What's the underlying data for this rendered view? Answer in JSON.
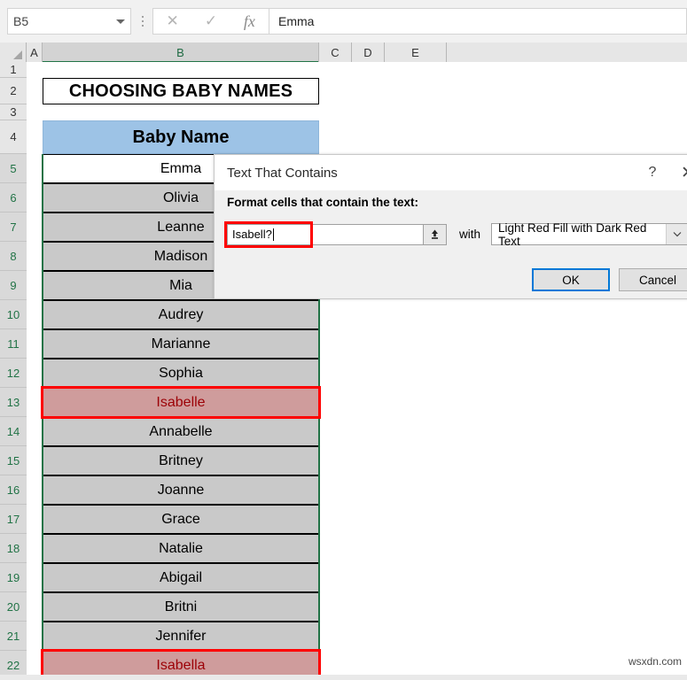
{
  "formula_bar": {
    "name_box_value": "B5",
    "cancel_icon": "close-icon",
    "enter_icon": "check-icon",
    "function_icon": "fx",
    "formula_value": "Emma"
  },
  "grid": {
    "columns": [
      "A",
      "B",
      "C",
      "D",
      "E"
    ],
    "selected_column": "B",
    "rows": [
      {
        "num": "1",
        "value": "",
        "type": "empty"
      },
      {
        "num": "2",
        "value": "CHOOSING BABY NAMES",
        "type": "title"
      },
      {
        "num": "3",
        "value": "",
        "type": "empty"
      },
      {
        "num": "4",
        "value": "Baby Name",
        "type": "header"
      },
      {
        "num": "5",
        "value": "Emma",
        "type": "data-active"
      },
      {
        "num": "6",
        "value": "Olivia",
        "type": "data"
      },
      {
        "num": "7",
        "value": "Leanne",
        "type": "data"
      },
      {
        "num": "8",
        "value": "Madison",
        "type": "data"
      },
      {
        "num": "9",
        "value": "Mia",
        "type": "data"
      },
      {
        "num": "10",
        "value": "Audrey",
        "type": "data"
      },
      {
        "num": "11",
        "value": "Marianne",
        "type": "data"
      },
      {
        "num": "12",
        "value": "Sophia",
        "type": "data"
      },
      {
        "num": "13",
        "value": "Isabelle",
        "type": "highlight"
      },
      {
        "num": "14",
        "value": "Annabelle",
        "type": "data"
      },
      {
        "num": "15",
        "value": "Britney",
        "type": "data"
      },
      {
        "num": "16",
        "value": "Joanne",
        "type": "data"
      },
      {
        "num": "17",
        "value": "Grace",
        "type": "data"
      },
      {
        "num": "18",
        "value": "Natalie",
        "type": "data"
      },
      {
        "num": "19",
        "value": "Abigail",
        "type": "data"
      },
      {
        "num": "20",
        "value": "Britni",
        "type": "data"
      },
      {
        "num": "21",
        "value": "Jennifer",
        "type": "data"
      },
      {
        "num": "22",
        "value": "Isabella",
        "type": "highlight"
      }
    ]
  },
  "dialog": {
    "title": "Text That Contains",
    "help_icon": "?",
    "close_icon": "✕",
    "instruction": "Format cells that contain the text:",
    "value_input": "Isabell?",
    "range_picker_icon": "collapse-dialog-icon",
    "with_label": "with",
    "format_selected": "Light Red Fill with Dark Red Text",
    "dropdown_icon": "chevron-down-icon",
    "ok_label": "OK",
    "cancel_label": "Cancel"
  },
  "colors": {
    "header_fill": "#9dc3e6",
    "data_fill": "#c9c9c9",
    "highlight_fill": "#cf9c9c",
    "highlight_text": "#9c0006",
    "selection_green": "#217346",
    "annotation_red": "#ff0000",
    "primary_blue": "#0078d7"
  },
  "watermark": "wsxdn.com"
}
